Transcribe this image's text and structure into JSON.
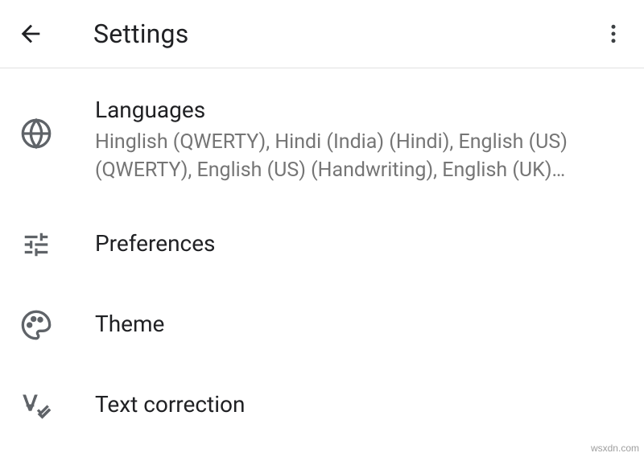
{
  "header": {
    "title": "Settings"
  },
  "items": [
    {
      "title": "Languages",
      "subtitle": "Hinglish (QWERTY), Hindi (India) (Hindi), English (US) (QWERTY), English (US) (Handwriting), English (UK) (QWERTY)"
    },
    {
      "title": "Preferences"
    },
    {
      "title": "Theme"
    },
    {
      "title": "Text correction"
    }
  ],
  "watermark": "wsxdn.com"
}
